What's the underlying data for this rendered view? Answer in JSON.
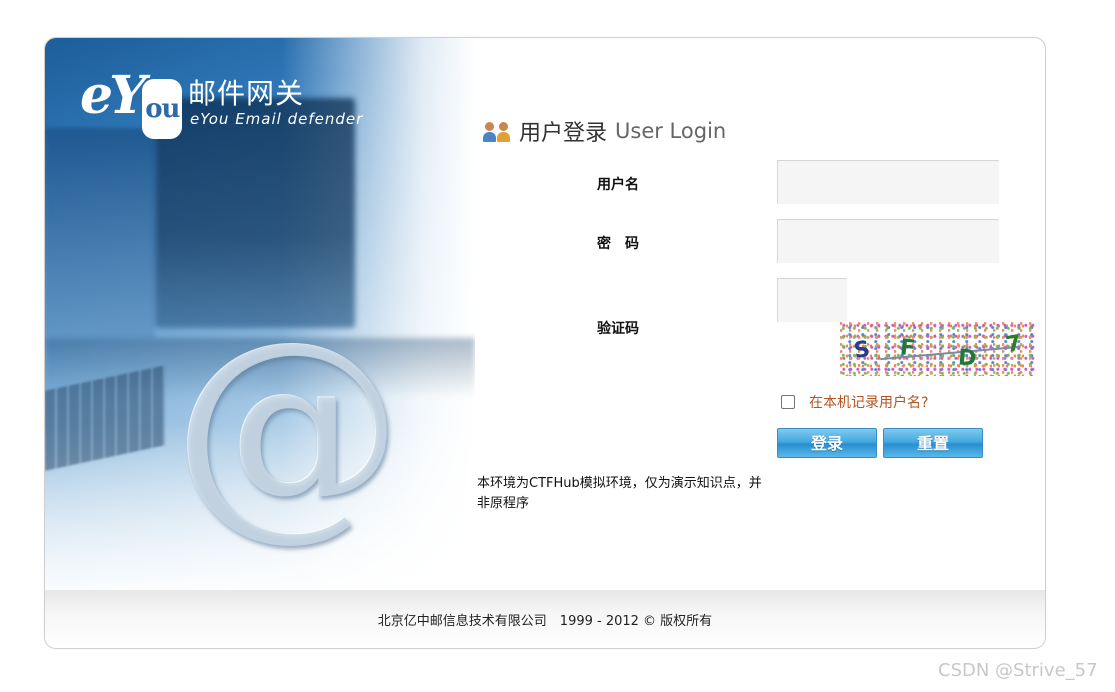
{
  "brand": {
    "logo_e": "e",
    "logo_y": "Y",
    "logo_ou": "ou",
    "name_cn": "邮件网关",
    "name_en": "eYou Email defender"
  },
  "login": {
    "title_cn": "用户登录",
    "title_en": "User Login",
    "username_label": "用户名",
    "password_label": "密　码",
    "captcha_label": "验证码",
    "username_value": "",
    "password_value": "",
    "captcha_value": "",
    "captcha_chars": [
      "S",
      "F",
      "D",
      "7"
    ],
    "remember_label": "在本机记录用户名?",
    "remember_checked": false,
    "login_button": "登录",
    "reset_button": "重置"
  },
  "notice": "本环境为CTFHub模拟环境，仅为演示知识点，并非原程序",
  "footer": "北京亿中邮信息技术有限公司　1999 - 2012 © 版权所有",
  "watermark": "CSDN @Strive_57",
  "colors": {
    "button_blue": "#45a9e0",
    "remember_text": "#b5541e",
    "hero_blue": "#2f78b8"
  },
  "icons": {
    "title_icon": "users-icon",
    "hero_symbol": "at-sign"
  },
  "hero_symbol_text": "@"
}
